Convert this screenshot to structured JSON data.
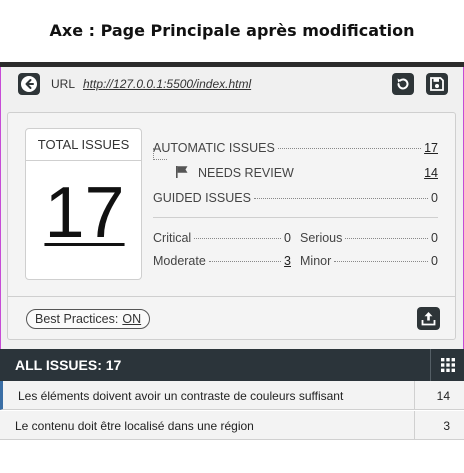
{
  "caption": "Axe : Page Principale après modification",
  "url_bar": {
    "label": "URL",
    "url": "http://127.0.0.1:5500/index.html"
  },
  "icons": {
    "back": "back-arrow-icon",
    "rescan": "refresh-icon",
    "save": "save-icon",
    "flag": "flag-icon",
    "export": "export-icon",
    "grid": "grid-icon"
  },
  "summary": {
    "total_label": "TOTAL ISSUES",
    "total_value": "17",
    "automatic_label": "AUTOMATIC ISSUES",
    "automatic_value": "17",
    "needs_review_label": "NEEDS REVIEW",
    "needs_review_value": "14",
    "guided_label": "GUIDED ISSUES",
    "guided_value": "0",
    "critical_label": "Critical",
    "critical_value": "0",
    "serious_label": "Serious",
    "serious_value": "0",
    "moderate_label": "Moderate",
    "moderate_value": "3",
    "minor_label": "Minor",
    "minor_value": "0"
  },
  "best_practices": {
    "label": "Best Practices:",
    "state": "ON"
  },
  "issues": {
    "header": "ALL ISSUES: 17",
    "rows": [
      {
        "text": "Les éléments doivent avoir un contraste de couleurs suffisant",
        "count": "14"
      },
      {
        "text": "Le contenu doit être localisé dans une région",
        "count": "3"
      }
    ]
  },
  "colors": {
    "panel_border": "#c64bd6",
    "header_bg": "#2b343a",
    "active_row_accent": "#3a6ea5"
  }
}
